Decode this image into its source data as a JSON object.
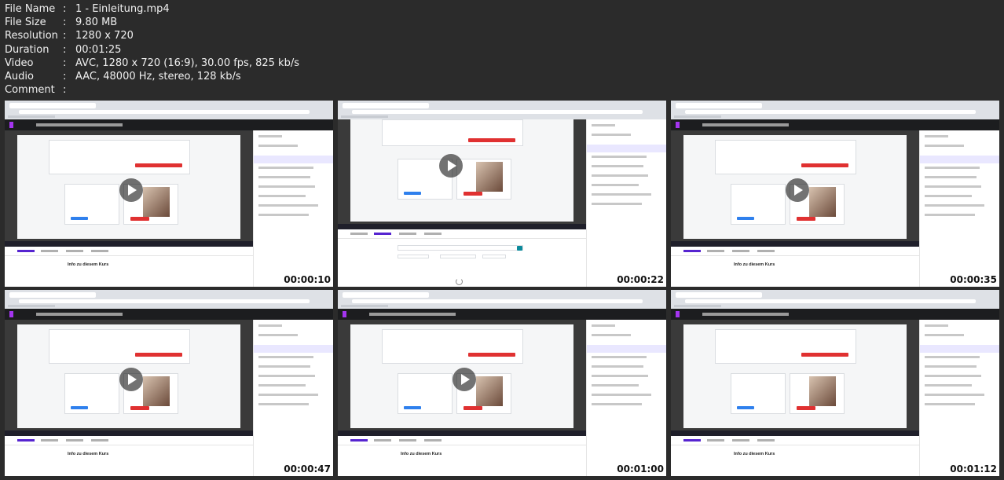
{
  "file_info": [
    {
      "key": "File Name",
      "value": "1 - Einleitung.mp4"
    },
    {
      "key": "File Size",
      "value": "9.80 MB"
    },
    {
      "key": "Resolution",
      "value": "1280 x 720"
    },
    {
      "key": "Duration",
      "value": "00:01:25"
    },
    {
      "key": "Video",
      "value": "AVC, 1280 x 720 (16:9), 30.00 fps, 825 kb/s"
    },
    {
      "key": "Audio",
      "value": "AAC, 48000 Hz, stereo, 128 kb/s"
    },
    {
      "key": "Comment",
      "value": ""
    }
  ],
  "separator": ":",
  "thumbnails": [
    {
      "timestamp": "00:00:10",
      "info_title": "Info zu diesem Kurs"
    },
    {
      "timestamp": "00:00:22",
      "info_title": ""
    },
    {
      "timestamp": "00:00:35",
      "info_title": "Info zu diesem Kurs"
    },
    {
      "timestamp": "00:00:47",
      "info_title": "Info zu diesem Kurs"
    },
    {
      "timestamp": "00:01:00",
      "info_title": "Info zu diesem Kurs"
    },
    {
      "timestamp": "00:01:12",
      "info_title": "Info zu diesem Kurs"
    }
  ],
  "colors": {
    "background": "#2b2b2b",
    "udemy_bar": "#1c1d1f",
    "accent": "#5624d0",
    "cta": "#e03131"
  }
}
